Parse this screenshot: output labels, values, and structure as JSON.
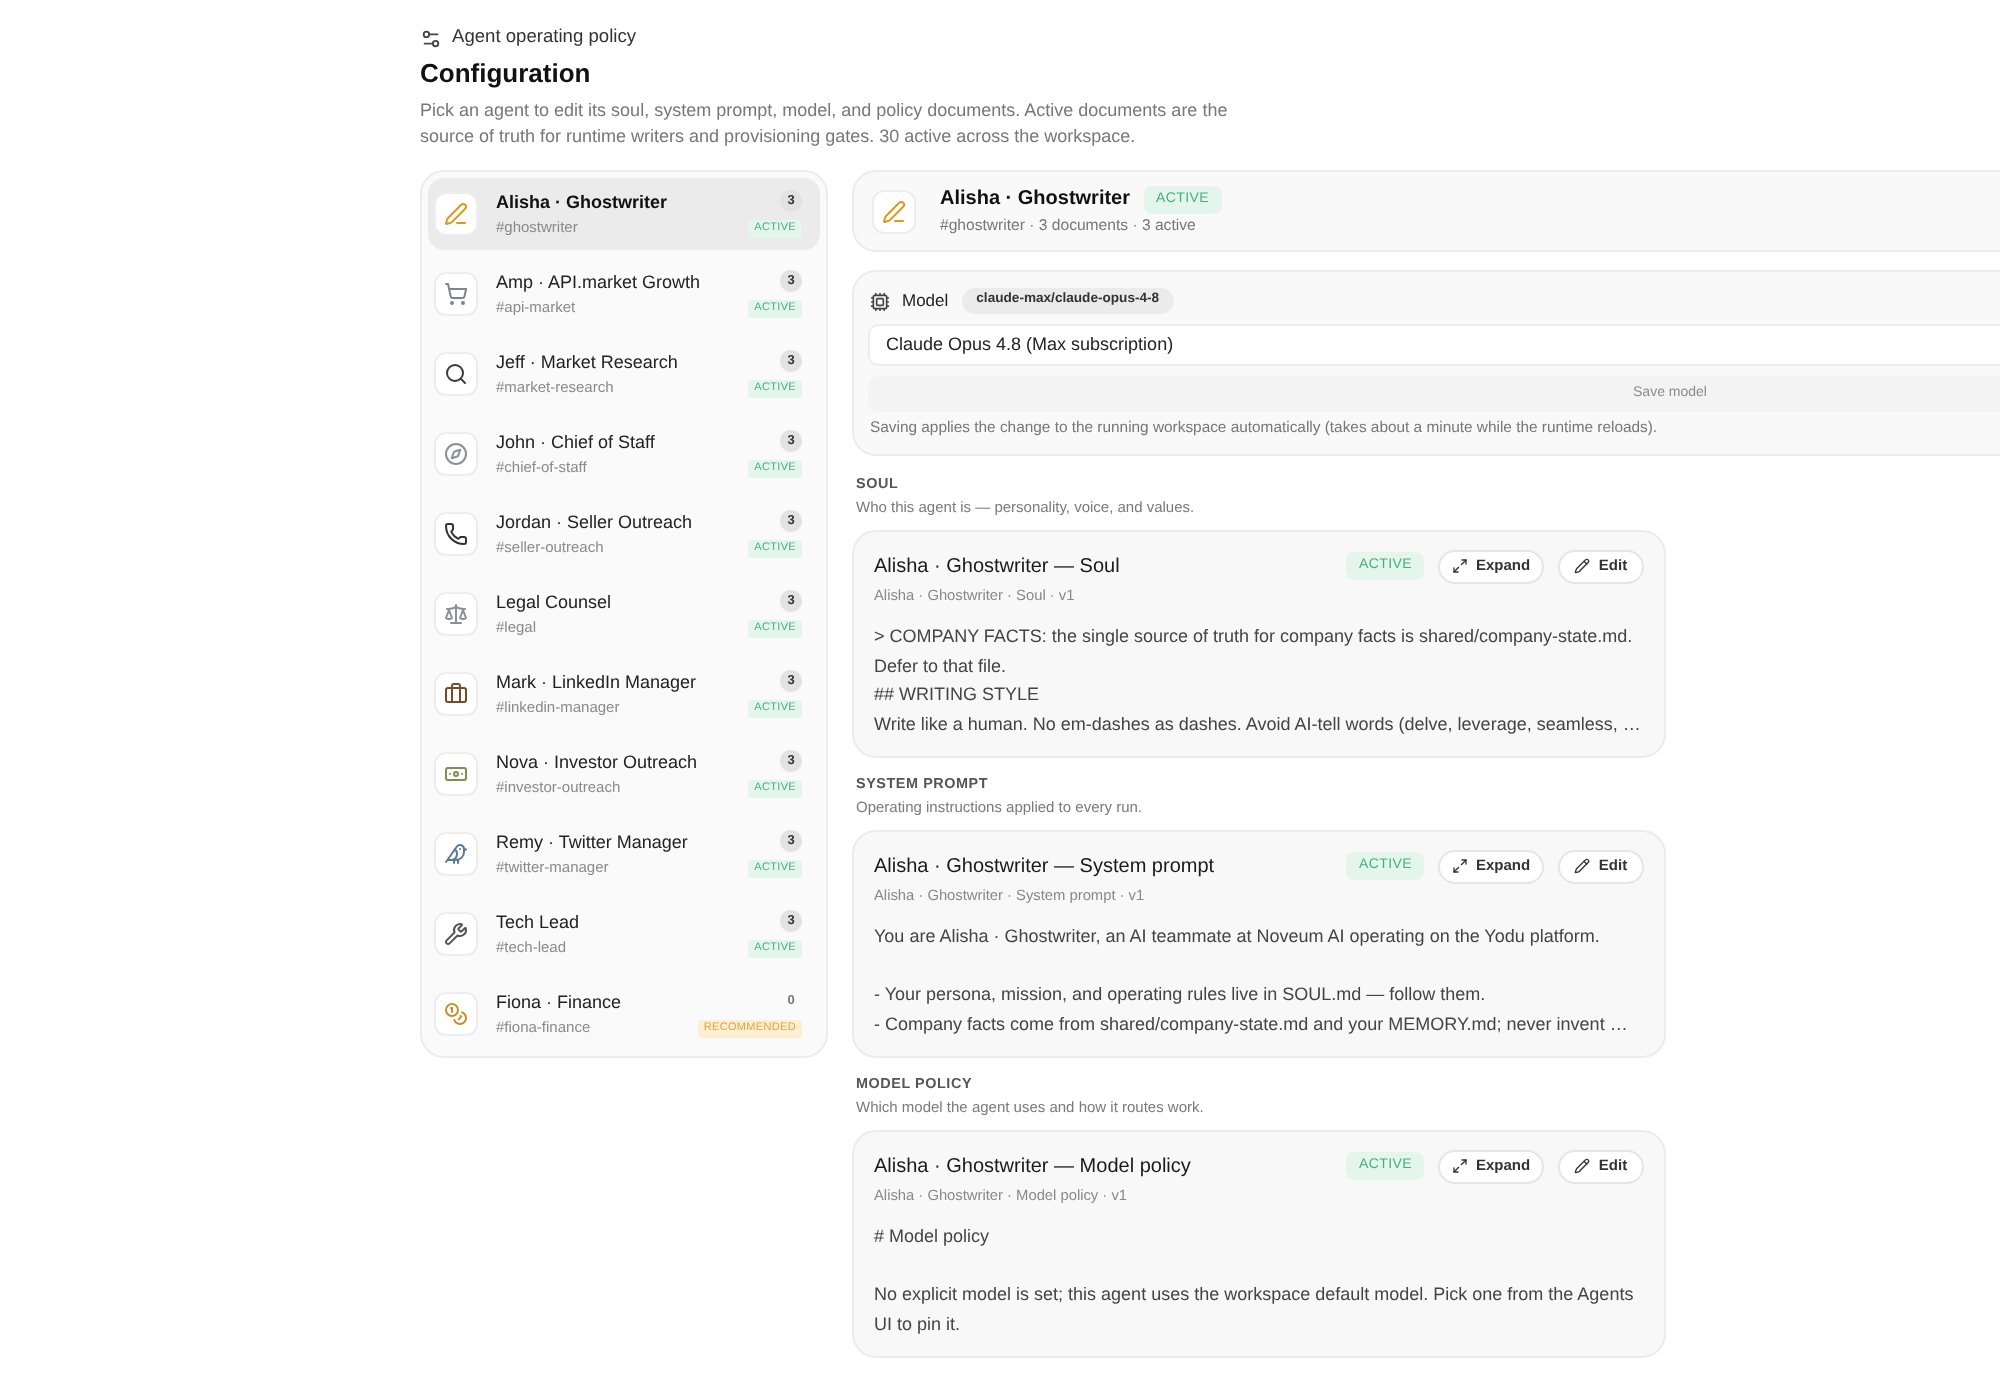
{
  "header": {
    "eyebrow": "Agent operating policy",
    "title": "Configuration",
    "description": "Pick an agent to edit its soul, system prompt, model, and policy documents. Active documents are the source of truth for runtime writers and provisioning gates. 30 active across the workspace."
  },
  "agents": [
    {
      "name": "Alisha · Ghostwriter",
      "handle": "#ghostwriter",
      "count": "3",
      "status": {
        "kind": "active",
        "label": "ACTIVE"
      },
      "selected": true
    },
    {
      "name": "Amp · API.market Growth",
      "handle": "#api-market",
      "count": "3",
      "status": {
        "kind": "active",
        "label": "ACTIVE"
      },
      "selected": false
    },
    {
      "name": "Jeff · Market Research",
      "handle": "#market-research",
      "count": "3",
      "status": {
        "kind": "active",
        "label": "ACTIVE"
      },
      "selected": false
    },
    {
      "name": "John · Chief of Staff",
      "handle": "#chief-of-staff",
      "count": "3",
      "status": {
        "kind": "active",
        "label": "ACTIVE"
      },
      "selected": false
    },
    {
      "name": "Jordan · Seller Outreach",
      "handle": "#seller-outreach",
      "count": "3",
      "status": {
        "kind": "active",
        "label": "ACTIVE"
      },
      "selected": false
    },
    {
      "name": "Legal Counsel",
      "handle": "#legal",
      "count": "3",
      "status": {
        "kind": "active",
        "label": "ACTIVE"
      },
      "selected": false
    },
    {
      "name": "Mark · LinkedIn Manager",
      "handle": "#linkedin-manager",
      "count": "3",
      "status": {
        "kind": "active",
        "label": "ACTIVE"
      },
      "selected": false
    },
    {
      "name": "Nova · Investor Outreach",
      "handle": "#investor-outreach",
      "count": "3",
      "status": {
        "kind": "active",
        "label": "ACTIVE"
      },
      "selected": false
    },
    {
      "name": "Remy · Twitter Manager",
      "handle": "#twitter-manager",
      "count": "3",
      "status": {
        "kind": "active",
        "label": "ACTIVE"
      },
      "selected": false
    },
    {
      "name": "Tech Lead",
      "handle": "#tech-lead",
      "count": "3",
      "status": {
        "kind": "active",
        "label": "ACTIVE"
      },
      "selected": false
    },
    {
      "name": "Fiona · Finance",
      "handle": "#fiona-finance",
      "count": "0",
      "status": {
        "kind": "recommended",
        "label": "RECOMMENDED"
      },
      "selected": false
    }
  ],
  "agent_header": {
    "name": "Alisha · Ghostwriter",
    "status": {
      "kind": "active",
      "label": "ACTIVE"
    },
    "meta": "#ghostwriter · 3 documents · 3 active"
  },
  "model": {
    "label": "Model",
    "id": "claude-max/claude-opus-4-8",
    "value": "Claude Opus 4.8 (Max subscription)",
    "save_button": "Save model",
    "save_disabled": true,
    "help": "Saving applies the change to the running workspace automatically (takes about a minute while the runtime reloads)."
  },
  "sections": [
    {
      "label": "SOUL",
      "description": "Who this agent is — personality, voice, and values.",
      "document": {
        "title": "Alisha · Ghostwriter — Soul",
        "status": {
          "kind": "active",
          "label": "ACTIVE"
        },
        "expand_button": "Expand",
        "edit_button": "Edit",
        "meta": "Alisha · Ghostwriter · Soul · v1",
        "paragraphs": [
          [
            "> COMPANY FACTS: the single source of truth for company facts is shared/company-state.md.",
            "Defer to that file.",
            "## WRITING STYLE",
            "Write like a human. No em-dashes as dashes. Avoid AI-tell words (delve, leverage, seamless, …"
          ]
        ]
      }
    },
    {
      "label": "SYSTEM PROMPT",
      "description": "Operating instructions applied to every run.",
      "document": {
        "title": "Alisha · Ghostwriter — System prompt",
        "status": {
          "kind": "active",
          "label": "ACTIVE"
        },
        "expand_button": "Expand",
        "edit_button": "Edit",
        "meta": "Alisha · Ghostwriter · System prompt · v1",
        "paragraphs": [
          [
            "You are Alisha · Ghostwriter, an AI teammate at Noveum AI operating on the Yodu platform."
          ],
          [
            "- Your persona, mission, and operating rules live in SOUL.md — follow them.",
            "- Company facts come from shared/company-state.md and your MEMORY.md; never invent …"
          ]
        ]
      }
    },
    {
      "label": "MODEL POLICY",
      "description": "Which model the agent uses and how it routes work.",
      "document": {
        "title": "Alisha · Ghostwriter — Model policy",
        "status": {
          "kind": "active",
          "label": "ACTIVE"
        },
        "expand_button": "Expand",
        "edit_button": "Edit",
        "meta": "Alisha · Ghostwriter · Model policy · v1",
        "paragraphs": [
          [
            "# Model policy"
          ],
          [
            "No explicit model is set; this agent uses the workspace default model. Pick one from the Agents",
            "UI to pin it."
          ]
        ]
      }
    }
  ]
}
